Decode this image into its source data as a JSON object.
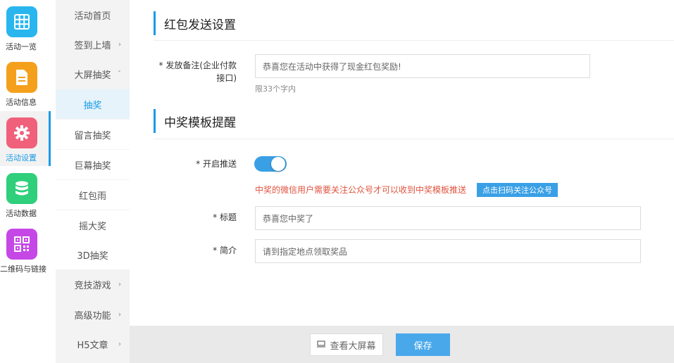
{
  "colors": {
    "accent": "#1a9be6",
    "warning": "#e0533f",
    "toggle_on": "#3aa0e6"
  },
  "rail": {
    "items": [
      {
        "label": "活动一览",
        "icon": "grid-icon",
        "color": "#29b6ef"
      },
      {
        "label": "活动信息",
        "icon": "document-icon",
        "color": "#f5a01d"
      },
      {
        "label": "活动设置",
        "icon": "gear-icon",
        "color": "#f0607a"
      },
      {
        "label": "活动数据",
        "icon": "database-icon",
        "color": "#2fcf7b"
      },
      {
        "label": "二维码与链接",
        "icon": "qrcode-icon",
        "color": "#c548e6"
      }
    ]
  },
  "subnav": {
    "items": [
      {
        "label": "活动首页",
        "arrow": ""
      },
      {
        "label": "签到上墙",
        "arrow": "›"
      },
      {
        "label": "大屏抽奖",
        "arrow": "ˇ"
      },
      {
        "label": "抽奖",
        "arrow": ""
      },
      {
        "label": "留言抽奖",
        "arrow": ""
      },
      {
        "label": "巨幕抽奖",
        "arrow": ""
      },
      {
        "label": "红包雨",
        "arrow": ""
      },
      {
        "label": "摇大奖",
        "arrow": ""
      },
      {
        "label": "3D抽奖",
        "arrow": ""
      },
      {
        "label": "竞技游戏",
        "arrow": "›"
      },
      {
        "label": "高级功能",
        "arrow": "›"
      },
      {
        "label": "H5文章",
        "arrow": "›"
      }
    ]
  },
  "section1": {
    "title": "红包发送设置",
    "remark_label_line1": "* 发放备注(企业付款",
    "remark_label_line2": "接口)",
    "remark_value": "恭喜您在活动中获得了现金红包奖励!",
    "remark_hint": "限33个字内"
  },
  "section2": {
    "title": "中奖模板提醒",
    "push_label": "* 开启推送",
    "push_on": true,
    "warning": "中奖的微信用户需要关注公众号才可以收到中奖模板推送",
    "qr_button": "点击扫码关注公众号",
    "title_label": "* 标题",
    "title_value": "恭喜您中奖了",
    "intro_label": "* 简介",
    "intro_value": "请到指定地点领取奖品"
  },
  "footer": {
    "preview": "查看大屏幕",
    "preview_icon": "monitor-icon",
    "save": "保存"
  }
}
